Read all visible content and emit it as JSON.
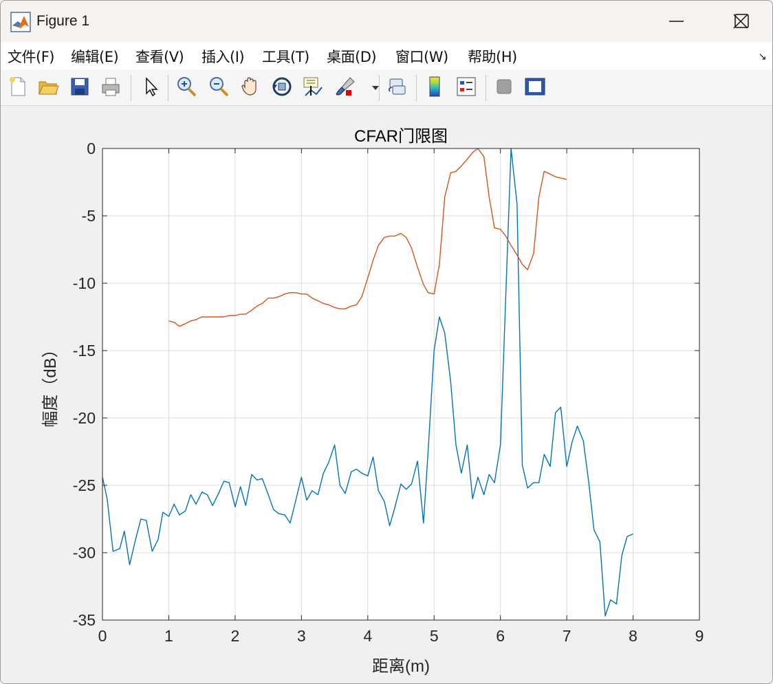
{
  "window": {
    "title": "Figure 1"
  },
  "menu": [
    "文件(F)",
    "编辑(E)",
    "查看(V)",
    "插入(I)",
    "工具(T)",
    "桌面(D)",
    "窗口(W)",
    "帮助(H)"
  ],
  "toolbar_icons": [
    "new-file-icon",
    "open-folder-icon",
    "save-icon",
    "print-icon",
    "pointer-icon",
    "zoom-in-icon",
    "zoom-out-icon",
    "pan-hand-icon",
    "rotate-3d-icon",
    "data-cursor-icon",
    "brush-icon",
    "link-icon",
    "colorbar-icon",
    "legend-icon",
    "hide-plot-tools-icon",
    "show-plot-tools-icon"
  ],
  "colors": {
    "series1": "#0072BD",
    "series2": "#D95319",
    "axes": "#262626",
    "grid": "#dcdcdc"
  },
  "chart_data": {
    "type": "line",
    "title": "CFAR门限图",
    "xlabel": "距离(m)",
    "ylabel": "幅度（dB）",
    "xlim": [
      0,
      9
    ],
    "ylim": [
      -35,
      0
    ],
    "xticks": [
      "0",
      "1",
      "2",
      "3",
      "4",
      "5",
      "6",
      "7",
      "8",
      "9"
    ],
    "yticks": [
      "0",
      "-5",
      "-10",
      "-15",
      "-20",
      "-25",
      "-30",
      "-35"
    ],
    "grid": true,
    "series": [
      {
        "x": [
          0.0,
          0.07,
          0.16,
          0.26,
          0.33,
          0.41,
          0.5,
          0.58,
          0.66,
          0.75,
          0.84,
          0.91,
          1.0,
          1.08,
          1.16,
          1.25,
          1.33,
          1.41,
          1.5,
          1.58,
          1.66,
          1.75,
          1.83,
          1.91,
          2.0,
          2.08,
          2.16,
          2.25,
          2.33,
          2.41,
          2.5,
          2.58,
          2.66,
          2.75,
          2.83,
          2.91,
          3.0,
          3.08,
          3.16,
          3.25,
          3.33,
          3.41,
          3.5,
          3.58,
          3.66,
          3.75,
          3.83,
          3.91,
          4.0,
          4.08,
          4.16,
          4.25,
          4.33,
          4.41,
          4.5,
          4.58,
          4.66,
          4.75,
          4.84,
          4.91,
          5.0,
          5.08,
          5.16,
          5.25,
          5.33,
          5.41,
          5.5,
          5.58,
          5.66,
          5.75,
          5.83,
          5.91,
          6.0,
          6.08,
          6.16,
          6.25,
          6.33,
          6.41,
          6.5,
          6.58,
          6.66,
          6.75,
          6.83,
          6.91,
          7.0,
          7.08,
          7.16,
          7.25,
          7.33,
          7.41,
          7.5,
          7.58,
          7.66,
          7.75,
          7.83,
          7.91,
          8.0
        ],
        "y": [
          -24.4,
          -26.0,
          -29.9,
          -29.7,
          -28.4,
          -30.9,
          -29.0,
          -27.5,
          -27.6,
          -29.9,
          -29.0,
          -27.0,
          -27.3,
          -26.4,
          -27.2,
          -26.9,
          -25.7,
          -26.4,
          -25.5,
          -25.7,
          -26.5,
          -25.6,
          -24.7,
          -24.8,
          -26.6,
          -25.1,
          -26.5,
          -24.2,
          -24.6,
          -24.5,
          -25.7,
          -26.8,
          -27.1,
          -27.2,
          -27.8,
          -26.2,
          -24.4,
          -26.1,
          -25.4,
          -25.7,
          -24.1,
          -23.3,
          -22.0,
          -25.0,
          -25.6,
          -24.0,
          -23.8,
          -24.1,
          -24.3,
          -22.9,
          -25.4,
          -26.2,
          -28.0,
          -26.6,
          -24.9,
          -25.3,
          -24.9,
          -23.2,
          -27.8,
          -22.5,
          -15.0,
          -12.5,
          -13.7,
          -17.3,
          -22.0,
          -24.1,
          -22.0,
          -26.0,
          -24.4,
          -25.7,
          -24.2,
          -24.8,
          -22.0,
          -11.0,
          0.0,
          -4.1,
          -23.5,
          -25.2,
          -24.8,
          -24.8,
          -22.7,
          -23.6,
          -19.6,
          -19.2,
          -23.6,
          -21.8,
          -20.6,
          -21.7,
          -24.7,
          -28.3,
          -29.2,
          -34.7,
          -33.5,
          -33.8,
          -30.2,
          -28.8,
          -28.6
        ]
      },
      {
        "x": [
          1.0,
          1.08,
          1.16,
          1.25,
          1.33,
          1.41,
          1.5,
          1.58,
          1.66,
          1.75,
          1.83,
          1.91,
          2.0,
          2.08,
          2.16,
          2.25,
          2.33,
          2.41,
          2.5,
          2.58,
          2.66,
          2.75,
          2.83,
          2.91,
          3.0,
          3.08,
          3.16,
          3.25,
          3.33,
          3.41,
          3.5,
          3.58,
          3.66,
          3.75,
          3.83,
          3.91,
          4.0,
          4.08,
          4.16,
          4.25,
          4.33,
          4.41,
          4.5,
          4.58,
          4.66,
          4.75,
          4.84,
          4.91,
          5.0,
          5.08,
          5.16,
          5.25,
          5.33,
          5.41,
          5.5,
          5.58,
          5.66,
          5.75,
          5.83,
          5.91,
          6.0,
          6.08,
          6.16,
          6.25,
          6.33,
          6.41,
          6.5,
          6.58,
          6.66,
          6.75,
          6.83,
          6.91,
          7.0
        ],
        "y": [
          -12.8,
          -12.9,
          -13.2,
          -13.0,
          -12.8,
          -12.7,
          -12.5,
          -12.5,
          -12.5,
          -12.5,
          -12.5,
          -12.4,
          -12.4,
          -12.3,
          -12.3,
          -12.0,
          -11.7,
          -11.5,
          -11.1,
          -11.1,
          -11.0,
          -10.8,
          -10.7,
          -10.7,
          -10.8,
          -10.8,
          -11.1,
          -11.3,
          -11.5,
          -11.6,
          -11.8,
          -11.9,
          -11.9,
          -11.7,
          -11.6,
          -11.0,
          -9.6,
          -8.3,
          -7.2,
          -6.6,
          -6.5,
          -6.5,
          -6.3,
          -6.6,
          -7.4,
          -8.8,
          -10.1,
          -10.7,
          -10.8,
          -8.6,
          -3.6,
          -1.8,
          -1.7,
          -1.3,
          -0.8,
          -0.3,
          0.0,
          -0.6,
          -3.6,
          -5.9,
          -6.0,
          -6.5,
          -7.2,
          -7.9,
          -8.6,
          -9.0,
          -7.8,
          -3.6,
          -1.7,
          -1.9,
          -2.1,
          -2.2,
          -2.3
        ]
      }
    ]
  }
}
